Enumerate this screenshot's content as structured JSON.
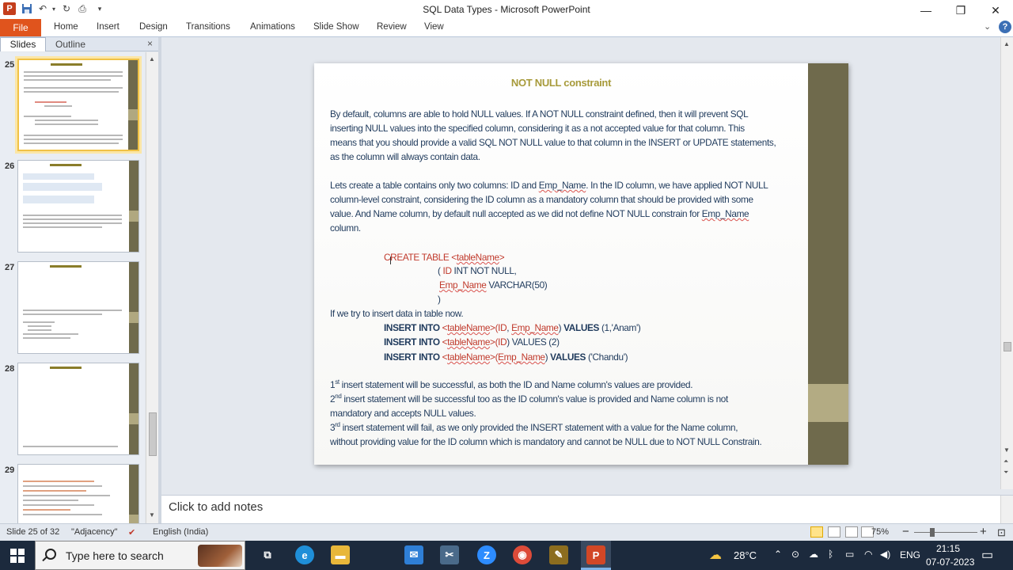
{
  "window": {
    "title": "SQL Data Types  -  Microsoft PowerPoint",
    "app_icon_label": "P",
    "minimize": "—",
    "restore": "❐",
    "close": "✕"
  },
  "ribbon": {
    "file": "File",
    "tabs": [
      "Home",
      "Insert",
      "Design",
      "Transitions",
      "Animations",
      "Slide Show",
      "Review",
      "View"
    ],
    "help": "?",
    "collapse": "⌄"
  },
  "pane": {
    "tab_slides": "Slides",
    "tab_outline": "Outline",
    "close": "×",
    "thumbnails": [
      {
        "num": "25",
        "selected": true
      },
      {
        "num": "26",
        "selected": false
      },
      {
        "num": "27",
        "selected": false
      },
      {
        "num": "28",
        "selected": false
      },
      {
        "num": "29",
        "selected": false
      }
    ]
  },
  "slide": {
    "title": "NOT NULL constraint",
    "p1": [
      "By default, columns are able to hold NULL values. If A NOT NULL constraint  defined, then it will prevent SQL",
      "inserting NULL values into the specified column, considering it as a not accepted value for that column. This",
      "means that you should provide  a valid SQL NOT NULL value to that column in the INSERT or UPDATE statements,",
      "as the column will always contain data."
    ],
    "p2_l1a": "Lets create a table contains only two columns: ID and ",
    "p2_l1b": "Emp_Name",
    "p2_l1c": ".  In the ID column,  we have applied  NOT NULL",
    "p2_l2": "column-level constraint, considering the ID column as a mandatory  column that should be provided with some",
    "p2_l3a": "value. And Name column, by default null accepted as we did not define NOT NULL constrain for ",
    "p2_l3b": "Emp_Name",
    "p2_l4": "column.",
    "create_a": "CREATE TABLE <",
    "create_b": "tableName",
    "create_c": ">",
    "c2_a": "( ",
    "c2_b": "ID",
    "c2_c": " INT NOT NULL,",
    "c3_a": "Emp_Name",
    "c3_b": " VARCHAR(50)",
    "c4": ")",
    "if_line": "If we try to insert data in table now.",
    "ins_kw": "INSERT INTO",
    "ins_lt": " <",
    "ins_tn": "tableName",
    "ins_gt": ">(",
    "ins1_id": "ID",
    "ins1_comma": ", ",
    "ins1_emp": "Emp_Name",
    "ins_close": ")",
    "ins_values_kw": " VALUES",
    "ins1_vals": " (1,'Anam')",
    "ins2_id": "ID",
    "ins2_close": ") VALUES (2)",
    "ins3_emp": "Emp_Name",
    "ins3_vals": " ('Chandu')",
    "r1_n": "1",
    "r1_sup": "st",
    "r1_t": " insert statement will be successful, as both the ID and Name column's values are provided.",
    "r2_n": "2",
    "r2_sup": "nd",
    "r2_t": " insert statement  will be successful too as the ID column's value is provided and Name column  is not",
    "r2_l2": "mandatory  and accepts NULL values.",
    "r3_n": "3",
    "r3_sup": "rd",
    "r3_t": "  insert statement will fail, as we only provided the INSERT statement with a value for the Name column,",
    "r3_l2": "without  providing value for the ID column which is mandatory and cannot be NULL due to NOT NULL Constrain."
  },
  "notes": {
    "placeholder": "Click to add notes"
  },
  "status": {
    "slide": "Slide 25 of 32",
    "theme": "\"Adjacency\"",
    "language": "English (India)",
    "zoom": "75%",
    "zoom_minus": "−",
    "zoom_plus": "+"
  },
  "taskbar": {
    "search_placeholder": "Type here to search",
    "apps": [
      {
        "name": "task-view",
        "glyph": "⧉",
        "color": "#1c2a3d"
      },
      {
        "name": "edge",
        "glyph": "e",
        "color": "#1f8fd8"
      },
      {
        "name": "file-explorer",
        "glyph": "▬",
        "color": "#e8b73a"
      },
      {
        "name": "mail",
        "glyph": "✉",
        "color": "#2f7fd6"
      },
      {
        "name": "snipping",
        "glyph": "✂",
        "color": "#4a6a8a"
      },
      {
        "name": "zoom",
        "glyph": "Z",
        "color": "#2d8cff"
      },
      {
        "name": "chrome",
        "glyph": "◉",
        "color": "#dd4b39"
      },
      {
        "name": "code-editor",
        "glyph": "✎",
        "color": "#8c6d1f"
      },
      {
        "name": "powerpoint",
        "glyph": "P",
        "color": "#d24726"
      }
    ],
    "temp": "28°C",
    "lang": "ENG",
    "time": "21:15",
    "date": "07-07-2023"
  }
}
